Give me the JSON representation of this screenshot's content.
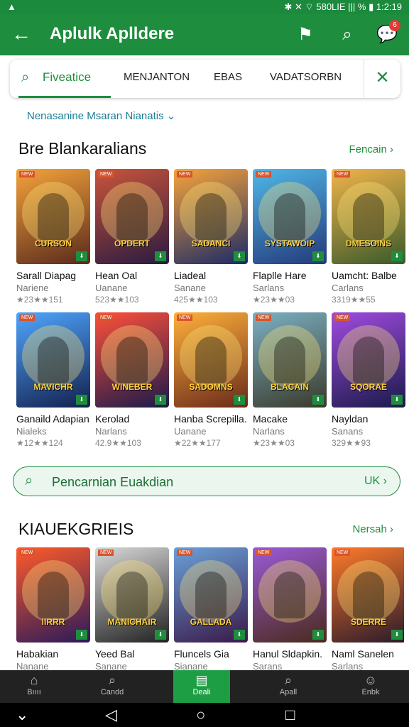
{
  "status": {
    "left": "▲",
    "right": "✱ ✕ ⌔ 580LIE ||| % ▮ 1:2:19"
  },
  "app": {
    "title": "Aplulk Apllderе",
    "badge": "6"
  },
  "tabs": {
    "items": [
      "Fiveatice",
      "MENJANTON",
      "EBAS",
      "VADATSORBN"
    ]
  },
  "filter": {
    "label": "Nenasanine Msaran Nianatis ⌄"
  },
  "section1": {
    "title": "Bre Blankaralians",
    "more": "Fencain ›",
    "cards": [
      {
        "name": "Sarall Diapag",
        "dev": "Nariene",
        "rating": "★23★★151",
        "logo": "CURSON",
        "c1": "#f4a23a",
        "c2": "#5a2a1c"
      },
      {
        "name": "Hean Oal",
        "dev": "Uanane",
        "rating": "523★★103",
        "logo": "OPDERT",
        "c1": "#c9543b",
        "c2": "#2a1a40"
      },
      {
        "name": "Liadeal",
        "dev": "Sanane",
        "rating": "425★★103",
        "logo": "SADANCI",
        "c1": "#f6a33a",
        "c2": "#1b2a66"
      },
      {
        "name": "Flaplle Hare",
        "dev": "Sarlans",
        "rating": "★23★★03",
        "logo": "SYSTAWOIP",
        "c1": "#4fb7e8",
        "c2": "#243a7a"
      },
      {
        "name": "Uamcht: Balbe",
        "dev": "Carlans",
        "rating": "3319★★55",
        "logo": "DMESOINS",
        "c1": "#f1b34a",
        "c2": "#3a5a2a"
      }
    ]
  },
  "section2": {
    "cards": [
      {
        "name": "Ganaild Adapian",
        "dev": "Nialeks",
        "rating": "★12★★124",
        "logo": "MAVICHR",
        "c1": "#4fa6ff",
        "c2": "#13204d"
      },
      {
        "name": "Kerolad",
        "dev": "Narlans",
        "rating": "42.9★★103",
        "logo": "WINEBER",
        "c1": "#ff4f3a",
        "c2": "#1a1a4a"
      },
      {
        "name": "Hanba Screpilla.",
        "dev": "Uanane",
        "rating": "★22★★177",
        "logo": "SADOMNS",
        "c1": "#ffb03a",
        "c2": "#6a2a1a"
      },
      {
        "name": "Macake",
        "dev": "Narlans",
        "rating": "★23★★03",
        "logo": "BLACAIN",
        "c1": "#7bb0c4",
        "c2": "#3a3a2a"
      },
      {
        "name": "Nayldan",
        "dev": "Sanans",
        "rating": "329★★93",
        "logo": "SQORAE",
        "c1": "#a04be0",
        "c2": "#1a1a4a"
      }
    ]
  },
  "search": {
    "label": "Pencarnian Euakdian",
    "action": "UK ›"
  },
  "section3": {
    "title": "KIAUEKGRIEIS",
    "more": "Nersah ›",
    "cards": [
      {
        "name": "Habakian",
        "dev": "Nanane",
        "rating": "",
        "logo": "IIRRR",
        "c1": "#ff5a2a",
        "c2": "#2a1a5a"
      },
      {
        "name": "Yeed Bal",
        "dev": "Sanane",
        "rating": "",
        "logo": "MANICHAIR",
        "c1": "#d8d8d8",
        "c2": "#222222"
      },
      {
        "name": "Fluncels Gia",
        "dev": "Sianane",
        "rating": "",
        "logo": "GALLADA",
        "c1": "#6aa0d8",
        "c2": "#3a1a4a"
      },
      {
        "name": "Hanul Sldapkin.",
        "dev": "Sarans",
        "rating": "",
        "logo": "",
        "c1": "#9a5ad8",
        "c2": "#4a2a1a"
      },
      {
        "name": "Naml Sanelen",
        "dev": "Sarlans",
        "rating": "",
        "logo": "SDERRE",
        "c1": "#ff7a2a",
        "c2": "#2a1a2a"
      }
    ]
  },
  "bottomnav": [
    {
      "icon": "⌂",
      "label": "Bıııı"
    },
    {
      "icon": "⌕",
      "label": "Candd"
    },
    {
      "icon": "▤",
      "label": "Deali"
    },
    {
      "icon": "⌕",
      "label": "Apall"
    },
    {
      "icon": "☺",
      "label": "Enbk"
    }
  ],
  "colors": {
    "primary": "#1e8e3e",
    "accent": "#1a7f96"
  }
}
